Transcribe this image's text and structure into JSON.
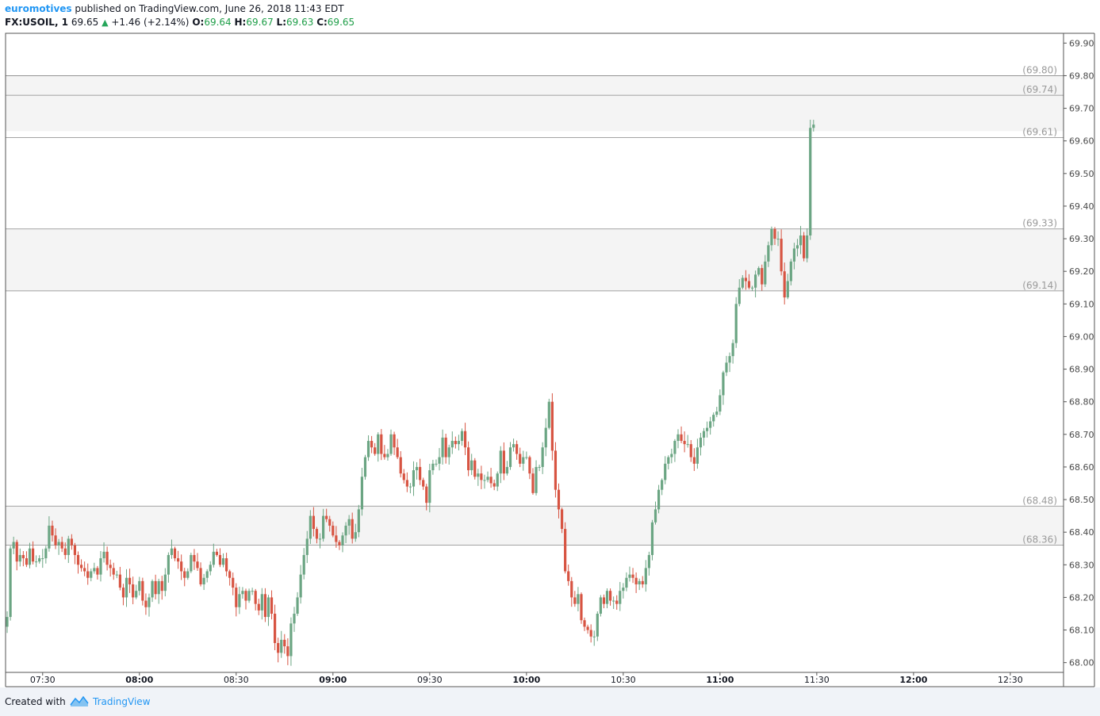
{
  "header": {
    "author": "euromotives",
    "published": " published on TradingView.com, June 26, 2018 11:43 EDT",
    "symbol": "FX:USOIL, 1",
    "last": "69.65",
    "change": "+1.46 (+2.14%)",
    "o_label": "O:",
    "o_value": "69.64",
    "h_label": "H:",
    "h_value": "69.67",
    "l_label": "L:",
    "l_value": "69.63",
    "c_label": "C:",
    "c_value": "69.65"
  },
  "footer": {
    "created": "Created with",
    "brand": "TradingView"
  },
  "colors": {
    "up": "#6ba583",
    "down": "#d75442",
    "level_line": "#868686",
    "zone_fill": "#f4f4f4",
    "axis_text": "#4a4a4a",
    "level_text": "#9a9a9a"
  },
  "chart_data": {
    "type": "candlestick",
    "ylim": [
      67.97,
      69.93
    ],
    "y_ticks": [
      "69.90",
      "69.80",
      "69.70",
      "69.60",
      "69.50",
      "69.40",
      "69.30",
      "69.20",
      "69.10",
      "69.00",
      "68.90",
      "68.80",
      "68.70",
      "68.60",
      "68.50",
      "68.40",
      "68.30",
      "68.20",
      "68.10",
      "68.00"
    ],
    "x_ticks": [
      {
        "label": "07:30",
        "bold": false,
        "min": 450
      },
      {
        "label": "08:00",
        "bold": true,
        "min": 480
      },
      {
        "label": "08:30",
        "bold": false,
        "min": 510
      },
      {
        "label": "09:00",
        "bold": true,
        "min": 540
      },
      {
        "label": "09:30",
        "bold": false,
        "min": 570
      },
      {
        "label": "10:00",
        "bold": true,
        "min": 600
      },
      {
        "label": "10:30",
        "bold": false,
        "min": 630
      },
      {
        "label": "11:00",
        "bold": true,
        "min": 660
      },
      {
        "label": "11:30",
        "bold": false,
        "min": 690
      },
      {
        "label": "12:00",
        "bold": true,
        "min": 720
      },
      {
        "label": "12:30",
        "bold": false,
        "min": 750
      }
    ],
    "x_range_min": [
      438.5,
      766.5
    ],
    "levels": [
      {
        "value": 69.8,
        "label": "(69.80)"
      },
      {
        "value": 69.74,
        "label": "(69.74)"
      },
      {
        "value": 69.61,
        "label": "(69.61)"
      },
      {
        "value": 69.33,
        "label": "(69.33)"
      },
      {
        "value": 69.14,
        "label": "(69.14)"
      },
      {
        "value": 68.48,
        "label": "(68.48)"
      },
      {
        "value": 68.36,
        "label": "(68.36)"
      }
    ],
    "zones": [
      [
        69.74,
        69.8
      ],
      [
        69.63,
        69.74
      ],
      [
        69.14,
        69.33
      ],
      [
        68.36,
        68.48
      ]
    ],
    "ohlc_start_time": "07:19",
    "ohlc_end_time": "11:43",
    "ohlc_closes": [
      68.14,
      68.35,
      68.37,
      68.31,
      68.33,
      68.32,
      68.3,
      68.35,
      68.31,
      68.31,
      68.32,
      68.32,
      68.35,
      68.42,
      68.39,
      68.36,
      68.37,
      68.35,
      68.33,
      68.38,
      68.36,
      68.33,
      68.3,
      68.29,
      68.28,
      68.26,
      68.28,
      68.29,
      68.27,
      68.32,
      68.34,
      68.3,
      68.29,
      68.27,
      68.27,
      68.23,
      68.2,
      68.26,
      68.24,
      68.2,
      68.22,
      68.25,
      68.19,
      68.17,
      68.2,
      68.25,
      68.21,
      68.25,
      68.22,
      68.27,
      68.33,
      68.35,
      68.32,
      68.31,
      68.28,
      68.26,
      68.28,
      68.33,
      68.31,
      68.29,
      68.24,
      68.26,
      68.28,
      68.3,
      68.34,
      68.33,
      68.3,
      68.32,
      68.28,
      68.26,
      68.23,
      68.17,
      68.21,
      68.22,
      68.19,
      68.22,
      68.22,
      68.18,
      68.16,
      68.21,
      68.14,
      68.2,
      68.15,
      68.06,
      68.03,
      68.07,
      68.05,
      68.02,
      68.12,
      68.15,
      68.2,
      68.27,
      68.33,
      68.38,
      68.45,
      68.41,
      68.38,
      68.38,
      68.45,
      68.44,
      68.42,
      68.39,
      68.37,
      68.36,
      68.39,
      68.42,
      68.44,
      68.38,
      68.4,
      68.47,
      68.57,
      68.63,
      68.68,
      68.66,
      68.64,
      68.7,
      68.64,
      68.63,
      68.64,
      68.7,
      68.66,
      68.63,
      68.58,
      68.56,
      68.54,
      68.54,
      68.59,
      68.6,
      68.56,
      68.54,
      68.49,
      68.59,
      68.61,
      68.61,
      68.63,
      68.69,
      68.63,
      68.66,
      68.68,
      68.67,
      68.68,
      68.71,
      68.66,
      68.59,
      68.62,
      68.57,
      68.58,
      68.56,
      68.56,
      68.57,
      68.55,
      68.54,
      68.58,
      68.65,
      68.58,
      68.6,
      68.66,
      68.67,
      68.64,
      68.61,
      68.63,
      68.63,
      68.58,
      68.52,
      68.6,
      68.6,
      68.66,
      68.72,
      68.8,
      68.65,
      68.53,
      68.47,
      68.41,
      68.28,
      68.25,
      68.2,
      68.18,
      68.21,
      68.13,
      68.11,
      68.1,
      68.08,
      68.08,
      68.15,
      68.2,
      68.18,
      68.22,
      68.19,
      68.19,
      68.18,
      68.22,
      68.23,
      68.26,
      68.27,
      68.26,
      68.24,
      68.25,
      68.24,
      68.29,
      68.33,
      68.43,
      68.47,
      68.53,
      68.56,
      68.61,
      68.63,
      68.64,
      68.68,
      68.7,
      68.68,
      68.67,
      68.67,
      68.63,
      68.61,
      68.66,
      68.69,
      68.71,
      68.72,
      68.74,
      68.76,
      68.77,
      68.82,
      68.89,
      68.92,
      68.94,
      68.98,
      69.1,
      69.15,
      69.18,
      69.17,
      69.15,
      69.15,
      69.19,
      69.21,
      69.16,
      69.23,
      69.28,
      69.33,
      69.3,
      69.3,
      69.2,
      69.12,
      69.17,
      69.23,
      69.27,
      69.28,
      69.31,
      69.24,
      69.31,
      69.64,
      69.65
    ]
  }
}
